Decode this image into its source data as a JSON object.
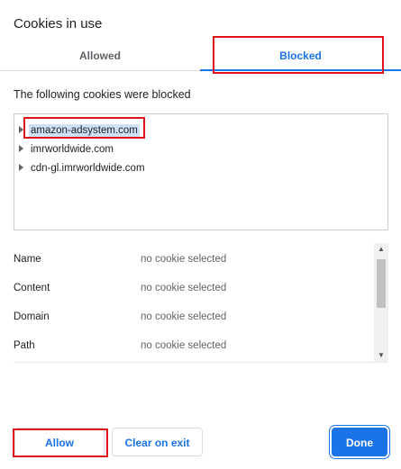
{
  "dialog": {
    "title": "Cookies in use"
  },
  "tabs": [
    {
      "label": "Allowed",
      "selected": false
    },
    {
      "label": "Blocked",
      "selected": true
    }
  ],
  "blocked": {
    "subtitle": "The following cookies were blocked",
    "sites": [
      {
        "label": "amazon-adsystem.com",
        "selected": true
      },
      {
        "label": "imrworldwide.com",
        "selected": false
      },
      {
        "label": "cdn-gl.imrworldwide.com",
        "selected": false
      }
    ]
  },
  "details": {
    "rows": [
      {
        "label": "Name",
        "value": "no cookie selected"
      },
      {
        "label": "Content",
        "value": "no cookie selected"
      },
      {
        "label": "Domain",
        "value": "no cookie selected"
      },
      {
        "label": "Path",
        "value": "no cookie selected"
      }
    ]
  },
  "buttons": {
    "allow": "Allow",
    "clear_on_exit": "Clear on exit",
    "done": "Done"
  },
  "icons": {
    "tree_expand": "triangle-right-icon",
    "scroll_up": "scroll-up-arrow-icon",
    "scroll_down": "scroll-down-arrow-icon"
  },
  "colors": {
    "accent": "#1a73e8",
    "annotation": "#e0121b",
    "selection": "#cfe1f8"
  }
}
